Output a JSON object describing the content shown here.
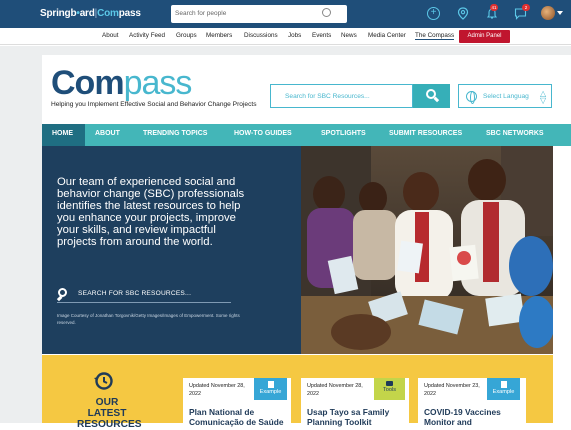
{
  "topbar": {
    "logo_left": "Springb",
    "logo_mid": "ard",
    "logo_sep": "|",
    "logo_com": "Com",
    "logo_pass": "pass",
    "search_placeholder": "Search for people",
    "notifications_count": "41",
    "messages_count": "2"
  },
  "subnav": {
    "items": [
      "About",
      "Activity Feed",
      "Groups",
      "Members",
      "Discussions",
      "Jobs",
      "Events",
      "News",
      "Media Center",
      "The Compass"
    ],
    "admin": "Admin Panel"
  },
  "header": {
    "brand_com": "Com",
    "brand_pass": "pass",
    "tagline": "Helping you Implement Effective Social and Behavior Change Projects",
    "search_placeholder": "Search for SBC Resources...",
    "language_label": "Select Languag"
  },
  "mainnav": {
    "items": [
      "HOME",
      "ABOUT",
      "TRENDING TOPICS",
      "HOW-TO GUIDES",
      "SPOTLIGHTS",
      "SUBMIT RESOURCES",
      "SBC NETWORKS"
    ]
  },
  "hero": {
    "text": "Our team of experienced social and behavior change (SBC) professionals identifies the latest resources to help you enhance your projects, improve your skills, and review impactful projects from around the world.",
    "search_label": "SEARCH FOR SBC RESOURCES...",
    "credit": "Image Courtesy of Jonathan Torgovnik/Getty Images/Images of Empowerment. Some rights reserved."
  },
  "latest": {
    "title": "OUR LATEST RESOURCES",
    "cards": [
      {
        "date": "Updated November 28, 2022",
        "tag": "Example",
        "title": "Plan National de Comunicação de Saúde"
      },
      {
        "date": "Updated November 28, 2022",
        "tag": "Tools",
        "title": "Usap Tayo sa Family Planning Toolkit"
      },
      {
        "date": "Updated November 23, 2022",
        "tag": "Example",
        "title": "COVID-19 Vaccines Monitor and"
      }
    ]
  },
  "colors": {
    "topbar": "#1f4e79",
    "accent": "#48b7ce",
    "nav": "#43b6b8",
    "hero": "#1e3f5e",
    "admin": "#c0152e",
    "latest_bg": "#f5c842",
    "tag_example": "#36a6d6",
    "tag_tools": "#c3d54a"
  }
}
